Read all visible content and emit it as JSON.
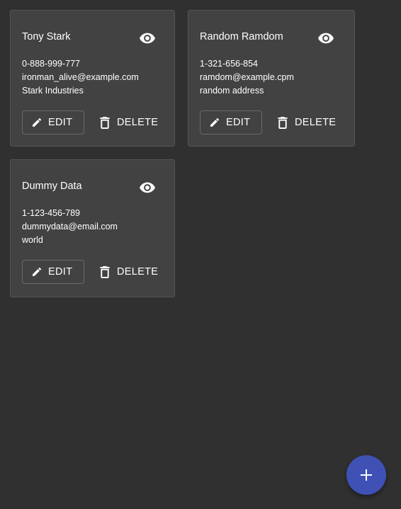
{
  "contacts": [
    {
      "name": "Tony Stark",
      "phone": "0-888-999-777",
      "email": "ironman_alive@example.com",
      "address": "Stark Industries",
      "edit_label": "EDIT",
      "delete_label": "DELETE"
    },
    {
      "name": "Random Ramdom",
      "phone": "1-321-656-854",
      "email": "ramdom@example.cpm",
      "address": "random address",
      "edit_label": "EDIT",
      "delete_label": "DELETE"
    },
    {
      "name": "Dummy Data",
      "phone": "1-123-456-789",
      "email": "dummydata@email.com",
      "address": "world",
      "edit_label": "EDIT",
      "delete_label": "DELETE"
    }
  ],
  "icons": {
    "view": "eye-icon",
    "edit": "pencil-icon",
    "delete": "trash-icon",
    "add": "plus-icon"
  },
  "colors": {
    "background": "#303030",
    "card": "#424242",
    "fab": "#3f51b5"
  }
}
